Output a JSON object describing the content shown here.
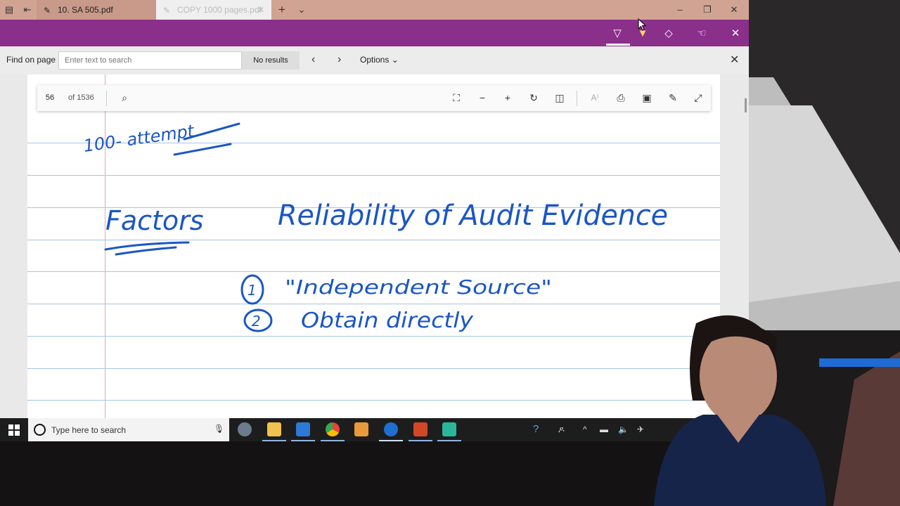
{
  "tabs": [
    {
      "title": "10. SA 505.pdf",
      "active": false
    },
    {
      "title": "COPY 1000 pages.pdf",
      "active": true
    }
  ],
  "findbar": {
    "label": "Find on page",
    "placeholder": "Enter text to search",
    "results": "No results",
    "options": "Options"
  },
  "pdf_toolbar": {
    "page": "56",
    "of": "of 1536"
  },
  "handwriting": {
    "line1": "100- attempt",
    "heading_left": "Factors",
    "heading_right": "Reliability of Audit Evidence",
    "item1_num": "1",
    "item1": "\"Independent Source\"",
    "item2_num": "2",
    "item2": "Obtain directly"
  },
  "taskbar": {
    "search_text": "Type here to search"
  },
  "colors": {
    "ink": "#1a56c4",
    "purple": "#8a2f8a",
    "tabbar": "#d0a393",
    "rule": "#a7c5e4"
  }
}
